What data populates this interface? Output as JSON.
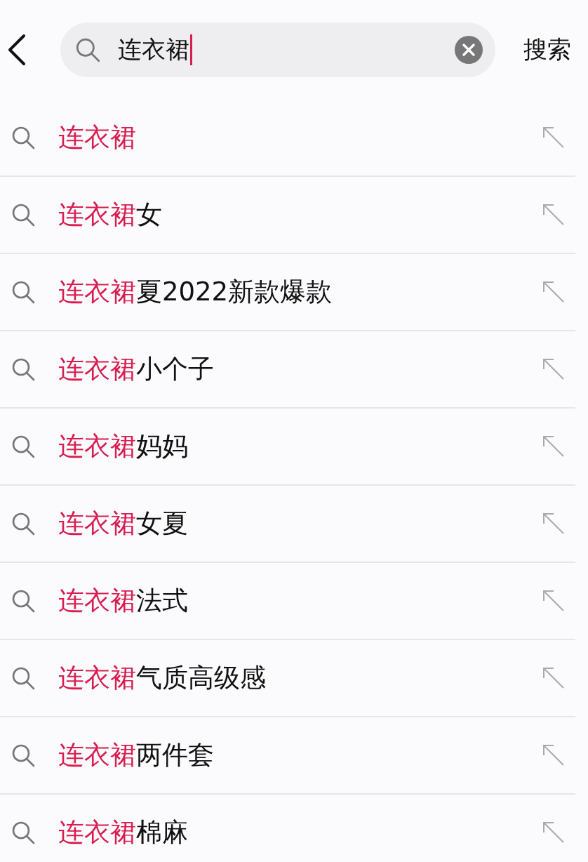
{
  "search": {
    "value": "连衣裙",
    "submit": "搜索"
  },
  "suggestions": [
    {
      "match": "连衣裙"
    },
    {
      "match": "连衣裙",
      "rest": "女"
    },
    {
      "match": "连衣裙",
      "rest": "夏2022新款爆款"
    },
    {
      "match": "连衣裙",
      "rest": "小个子"
    },
    {
      "match": "连衣裙",
      "rest": "妈妈"
    },
    {
      "match": "连衣裙",
      "rest": "女夏"
    },
    {
      "match": "连衣裙",
      "rest": "法式"
    },
    {
      "match": "连衣裙",
      "rest": "气质高级感"
    },
    {
      "match": "连衣裙",
      "rest": "两件套"
    },
    {
      "match": "连衣裙",
      "rest": "棉麻"
    }
  ]
}
